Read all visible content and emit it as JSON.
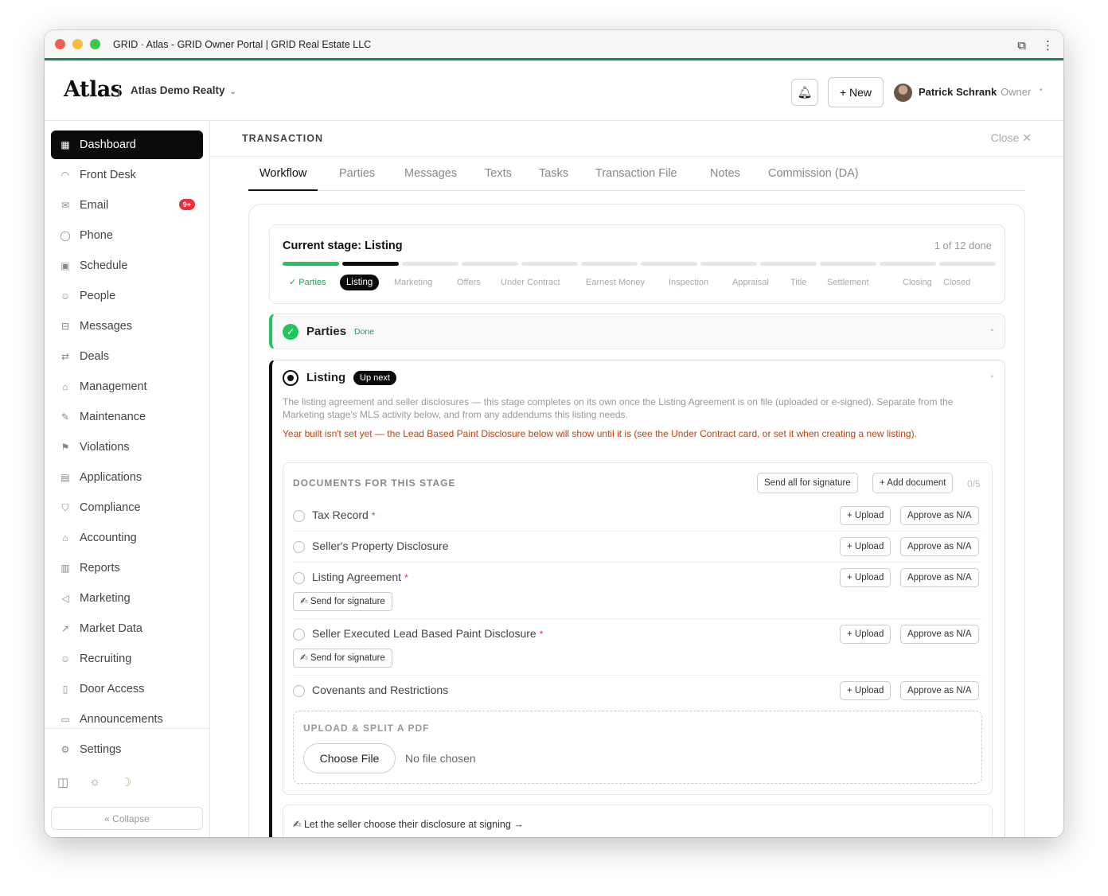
{
  "window": {
    "title": "GRID · Atlas - GRID Owner Portal | GRID Real Estate LLC",
    "traffic_colors": [
      "#ee5f56",
      "#f6bd3b",
      "#3dc84a"
    ],
    "accent": "#17884a"
  },
  "header": {
    "logo": "Atlas",
    "org": "Atlas Demo Realty",
    "new_label": "+ New",
    "user_name": "Patrick Schrank",
    "user_role": "Owner"
  },
  "sidebar": {
    "items": [
      {
        "label": "Dashboard",
        "icon": "grid-icon",
        "active": true
      },
      {
        "label": "Front Desk",
        "icon": "headset-icon"
      },
      {
        "label": "Email",
        "icon": "mail-icon",
        "badge": "9+"
      },
      {
        "label": "Phone",
        "icon": "chat-icon"
      },
      {
        "label": "Schedule",
        "icon": "calendar-check-icon"
      },
      {
        "label": "People",
        "icon": "users-icon"
      },
      {
        "label": "Messages",
        "icon": "inbox-icon"
      },
      {
        "label": "Deals",
        "icon": "repeat-icon"
      },
      {
        "label": "Management",
        "icon": "home-icon"
      },
      {
        "label": "Maintenance",
        "icon": "wrench-icon"
      },
      {
        "label": "Violations",
        "icon": "flag-icon"
      },
      {
        "label": "Applications",
        "icon": "document-icon"
      },
      {
        "label": "Compliance",
        "icon": "shield-check-icon"
      },
      {
        "label": "Accounting",
        "icon": "bank-icon"
      },
      {
        "label": "Reports",
        "icon": "bar-chart-icon"
      },
      {
        "label": "Marketing",
        "icon": "megaphone-icon"
      },
      {
        "label": "Market Data",
        "icon": "trend-icon"
      },
      {
        "label": "Recruiting",
        "icon": "user-plus-icon"
      },
      {
        "label": "Door Access",
        "icon": "door-icon"
      },
      {
        "label": "Announcements",
        "icon": "chat-bubble-icon"
      }
    ],
    "settings": "Settings",
    "collapse": "« Collapse"
  },
  "main": {
    "section_label": "TRANSACTION",
    "close_label": "Close",
    "tabs": [
      "Workflow",
      "Parties",
      "Messages",
      "Texts",
      "Tasks",
      "Transaction File",
      "Notes",
      "Commission (DA)"
    ],
    "active_tab": "Workflow"
  },
  "stage": {
    "title": "Current stage: Listing",
    "count": "1 of 12 done",
    "stages": [
      {
        "label": "✓ Parties",
        "state": "done"
      },
      {
        "label": "Listing",
        "state": "current"
      },
      {
        "label": "Marketing",
        "state": "pending"
      },
      {
        "label": "Offers",
        "state": "pending"
      },
      {
        "label": "Under Contract",
        "state": "pending"
      },
      {
        "label": "Earnest Money",
        "state": "pending"
      },
      {
        "label": "Inspection",
        "state": "pending"
      },
      {
        "label": "Appraisal",
        "state": "pending"
      },
      {
        "label": "Title",
        "state": "pending"
      },
      {
        "label": "Settlement",
        "state": "pending"
      },
      {
        "label": "Closing",
        "state": "pending"
      },
      {
        "label": "Closed",
        "state": "pending"
      }
    ],
    "colors": {
      "done": "#22c55e",
      "current": "#0b0b0b",
      "pending": "#e6e6e6"
    }
  },
  "parties_row": {
    "title": "Parties",
    "status": "Done"
  },
  "listing": {
    "title": "Listing",
    "tag": "Up next",
    "description": "The listing agreement and seller disclosures — this stage completes on its own once the Listing Agreement is on file (uploaded or e-signed). Separate from the Marketing stage's MLS activity below, and from any addendums this listing needs.",
    "warning": "Year built isn't set yet — the Lead Based Paint Disclosure below will show until it is (see the Under Contract card, or set it when creating a new listing).",
    "docs_header": "DOCUMENTS FOR THIS STAGE",
    "send_all": "Send all for signature",
    "add_document": "+ Add document",
    "doc_count": "0/5",
    "upload_label": "+ Upload",
    "approve_label": "Approve as N/A",
    "signature_label": "✍ Send for signature",
    "documents": [
      {
        "name": "Tax Record",
        "required": true,
        "signature": false
      },
      {
        "name": "Seller's Property Disclosure",
        "required": false,
        "signature": false
      },
      {
        "name": "Listing Agreement",
        "required": true,
        "signature": true
      },
      {
        "name": "Seller Executed Lead Based Paint Disclosure",
        "required": true,
        "signature": true
      },
      {
        "name": "Covenants and Restrictions",
        "required": false,
        "signature": false
      }
    ],
    "upload_split_header": "UPLOAD & SPLIT A PDF",
    "choose_file": "Choose File",
    "no_file": "No file chosen",
    "chooser_text": "✍ Let the seller choose their disclosure at signing →"
  }
}
